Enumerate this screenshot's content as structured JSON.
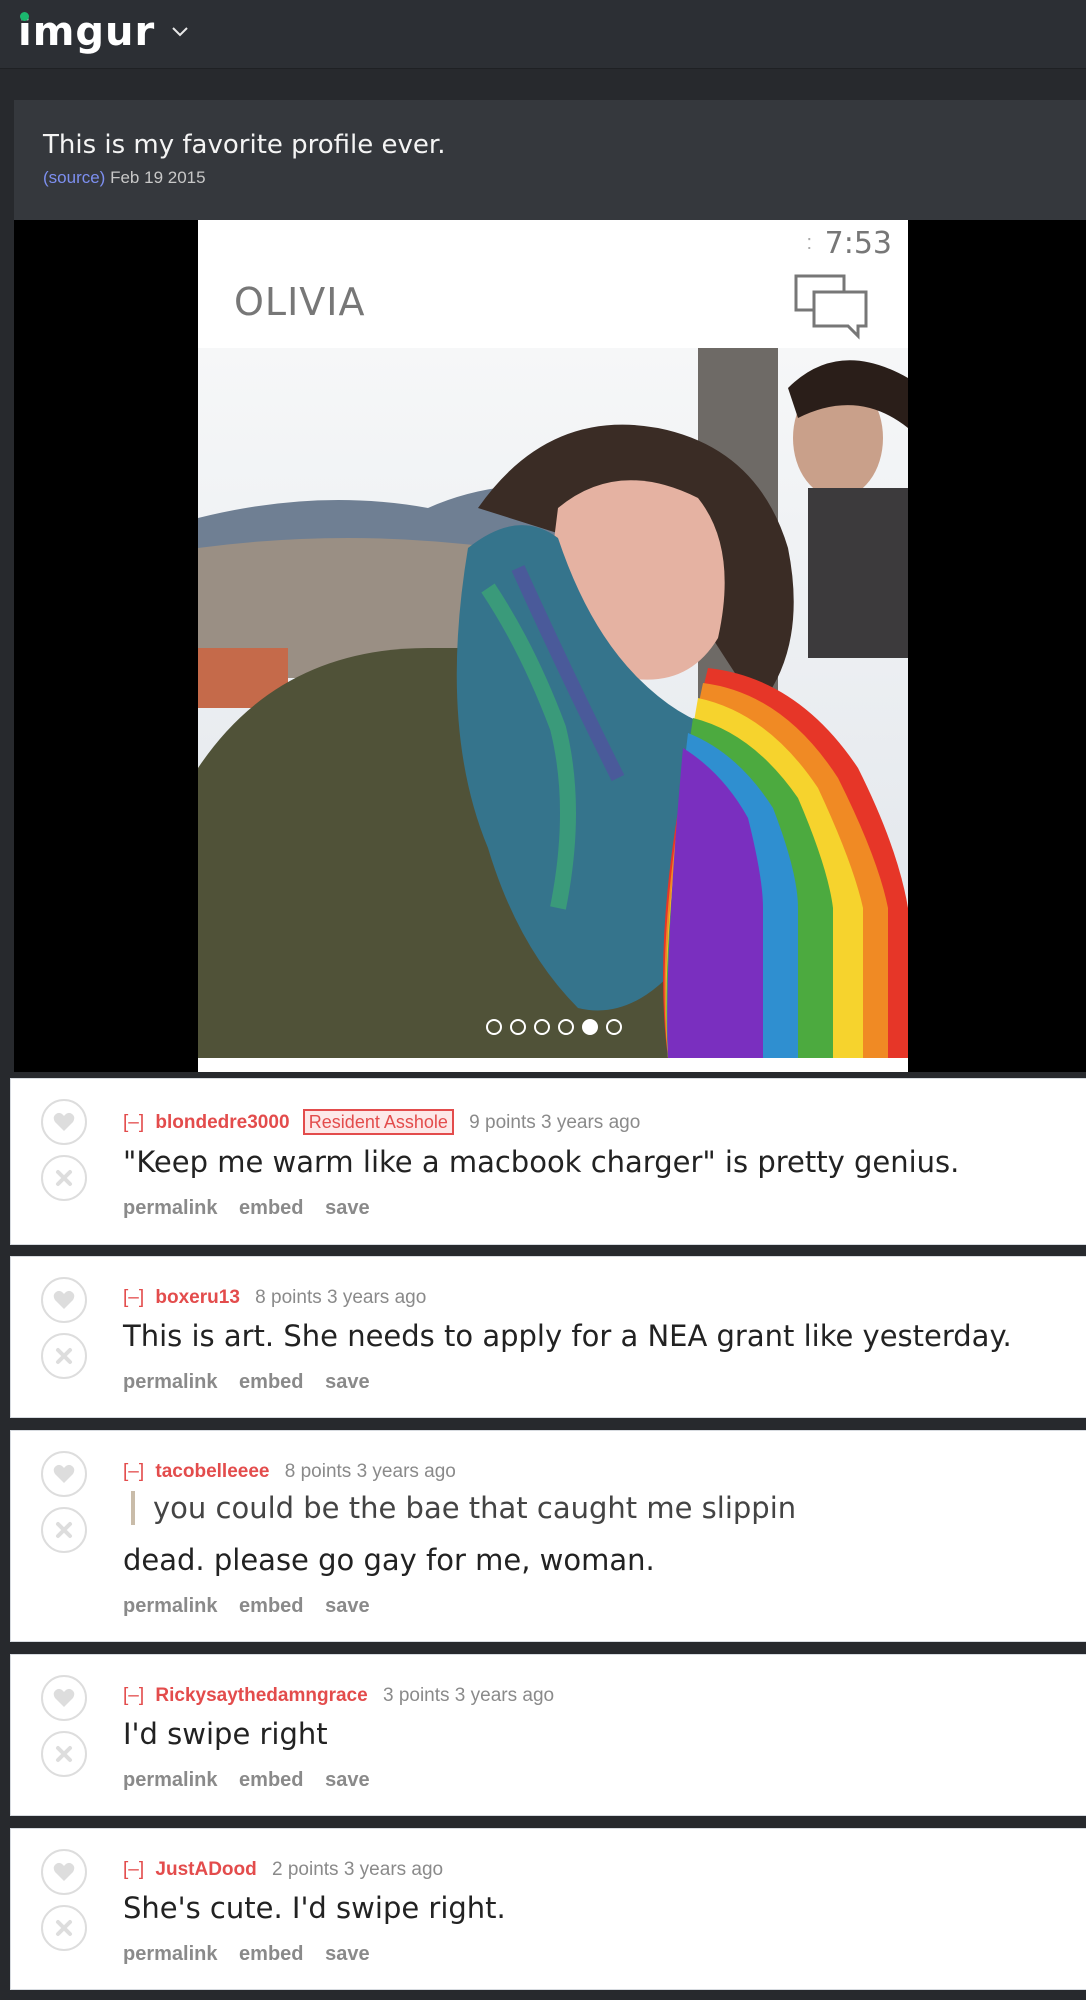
{
  "header": {
    "logo": "imgur"
  },
  "post": {
    "title": "This is my favorite profile ever.",
    "source_label": "(source)",
    "date": "Feb 19 2015"
  },
  "phone": {
    "time": "7:53",
    "colon": ":",
    "profile_name": "OLIVIA"
  },
  "comment_actions": {
    "permalink": "permalink",
    "embed": "embed",
    "save": "save"
  },
  "comments": [
    {
      "collapse": "[–]",
      "author": "blondedre3000",
      "flair": "Resident Asshole",
      "points": "9 points 3 years ago",
      "body": "\"Keep me warm like a macbook charger\" is pretty genius."
    },
    {
      "collapse": "[–]",
      "author": "boxeru13",
      "points": "8 points 3 years ago",
      "body": "This is art. She needs to apply for a NEA grant like yesterday."
    },
    {
      "collapse": "[–]",
      "author": "tacobelleeee",
      "points": "8 points 3 years ago",
      "quote": "you could be the bae that caught me slippin",
      "body": "dead. please go gay for me, woman."
    },
    {
      "collapse": "[–]",
      "author": "Rickysaythedamngrace",
      "points": "3 points 3 years ago",
      "body": "I'd swipe right"
    },
    {
      "collapse": "[–]",
      "author": "JustADood",
      "points": "2 points 3 years ago",
      "body": "She's cute. I'd swipe right."
    }
  ],
  "colors": {
    "accent_red": "#e34c4c",
    "source_link": "#7d8ff0",
    "logo_green": "#1bb76e"
  }
}
